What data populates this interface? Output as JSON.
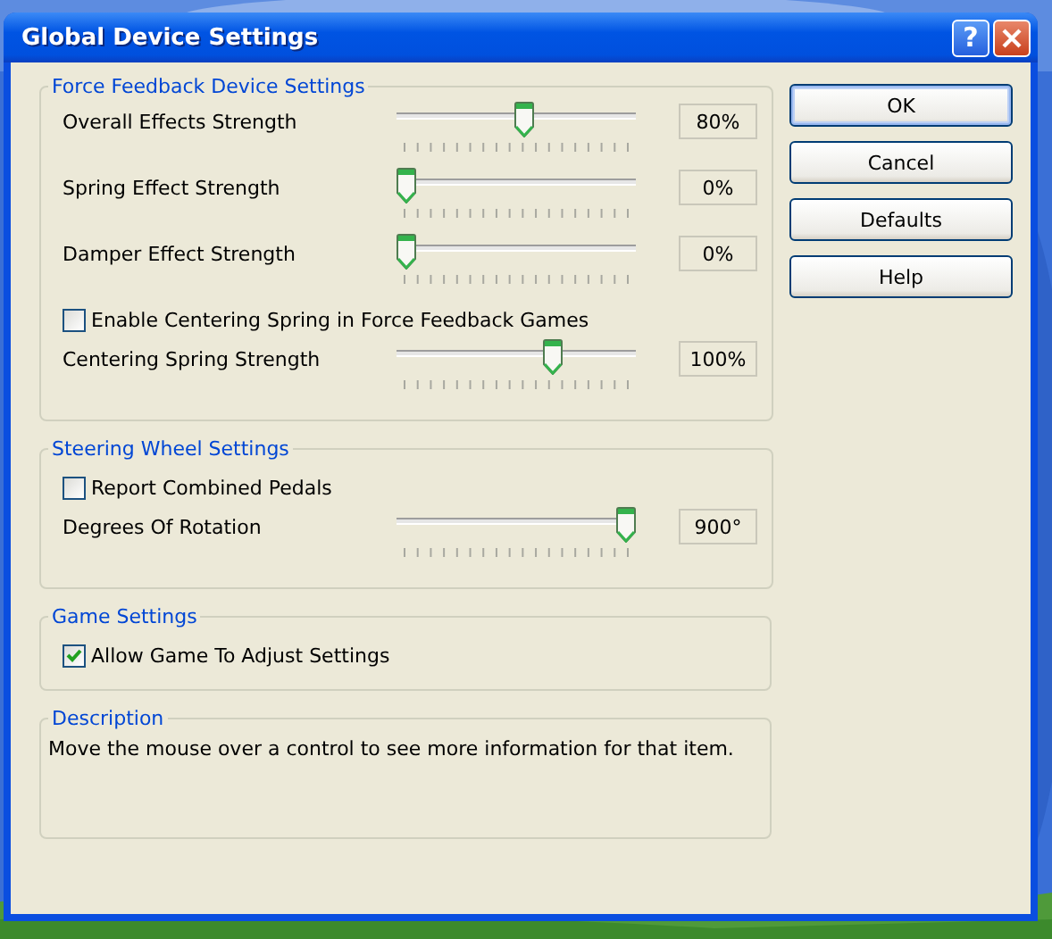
{
  "window": {
    "title": "Global Device Settings",
    "help_glyph": "?"
  },
  "groups": [
    {
      "title": "Force Feedback Device Settings",
      "items": [
        {
          "kind": "slider",
          "label": "Overall Effects Strength",
          "level": 0.54,
          "reading": "80%"
        },
        {
          "kind": "slider",
          "label": "Spring Effect Strength",
          "level": 0,
          "reading": "0%"
        },
        {
          "kind": "slider",
          "label": "Damper Effect Strength",
          "level": 0,
          "reading": "0%"
        },
        {
          "kind": "checkbox",
          "label": "Enable Centering Spring in Force Feedback Games",
          "checked": false
        },
        {
          "kind": "slider",
          "label": "Centering Spring Strength",
          "level": 0.67,
          "reading": "100%"
        }
      ]
    },
    {
      "title": "Steering Wheel Settings",
      "items": [
        {
          "kind": "checkbox",
          "label": "Report Combined Pedals",
          "checked": false
        },
        {
          "kind": "slider",
          "label": "Degrees Of Rotation",
          "level": 1,
          "reading": "900°"
        }
      ]
    },
    {
      "title": "Game Settings",
      "items": [
        {
          "kind": "checkbox",
          "label": "Allow Game To Adjust Settings",
          "checked": true
        }
      ]
    },
    {
      "title": "Description",
      "items": [
        {
          "kind": "text",
          "text": "Move the mouse over a control to see more information for that item."
        }
      ]
    }
  ],
  "buttons": [
    {
      "label": "OK",
      "default": true
    },
    {
      "label": "Cancel",
      "default": false
    },
    {
      "label": "Defaults",
      "default": false
    },
    {
      "label": "Help",
      "default": false
    }
  ]
}
